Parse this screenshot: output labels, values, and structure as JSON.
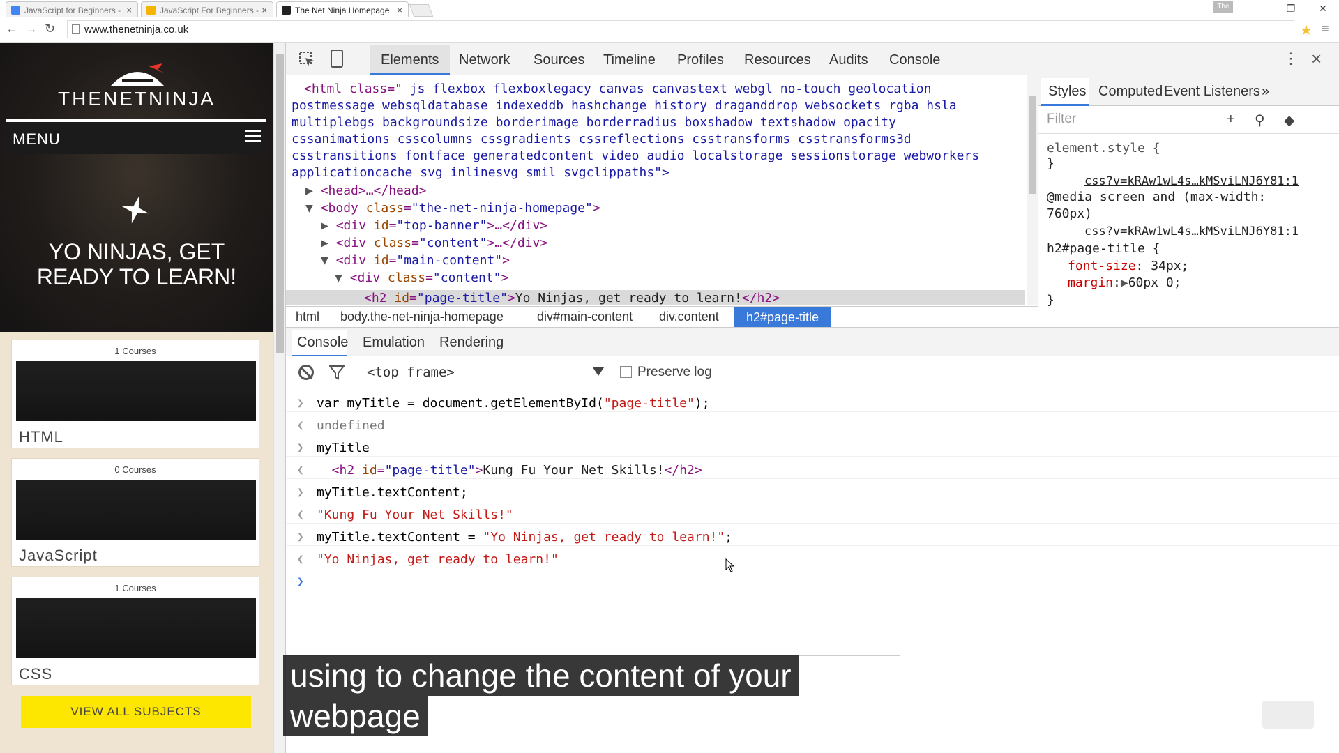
{
  "browser": {
    "tabs": [
      {
        "title": "JavaScript for Beginners -",
        "active": false,
        "favicon_color": "#4285f4"
      },
      {
        "title": "JavaScript For Beginners -",
        "active": false,
        "favicon_color": "#f4b400"
      },
      {
        "title": "The Net Ninja Homepage",
        "active": true,
        "favicon_color": "#222222"
      }
    ],
    "user_badge": "The",
    "window_controls": {
      "minimize": "–",
      "restore": "❐",
      "close": "✕"
    },
    "url": "www.thenetninja.co.uk"
  },
  "site": {
    "logo_text": "THENETNINJA",
    "menu_label": "MENU",
    "hero_title_line1": "YO NINJAS, GET",
    "hero_title_line2": "READY TO LEARN!",
    "cards": [
      {
        "count": "1 Courses",
        "name": "HTML"
      },
      {
        "count": "0 Courses",
        "name": "JavaScript"
      },
      {
        "count": "1 Courses",
        "name": "CSS"
      }
    ],
    "view_all": "VIEW ALL SUBJECTS",
    "accent": "#fde600",
    "logo_accent": "#e8332a"
  },
  "devtools": {
    "tabs": [
      "Elements",
      "Network",
      "Sources",
      "Timeline",
      "Profiles",
      "Resources",
      "Audits",
      "Console"
    ],
    "active_tab": "Elements",
    "elements": {
      "html_open": "<html class=\"",
      "html_classes_1": " js flexbox flexboxlegacy canvas canvastext webgl no-touch geolocation",
      "html_classes_2": "postmessage websqldatabase indexeddb hashchange history draganddrop websockets rgba hsla",
      "html_classes_3": "multiplebgs backgroundsize borderimage borderradius boxshadow textshadow opacity",
      "html_classes_4": "cssanimations csscolumns cssgradients cssreflections csstransforms csstransforms3d",
      "html_classes_5": "csstransitions fontface generatedcontent video audio localstorage sessionstorage webworkers",
      "html_classes_6": "applicationcache svg inlinesvg smil svgclippaths",
      "html_close": "\">",
      "head": "<head>…</head>",
      "body_tag": "<body",
      "body_attr": "class",
      "body_val": "\"the-net-ninja-homepage\"",
      "div1_attr": "id",
      "div1_val": "\"top-banner\"",
      "div2_attr": "class",
      "div2_val": "\"content\"",
      "div3_attr": "id",
      "div3_val": "\"main-content\"",
      "div4_attr": "class",
      "div4_val": "\"content\"",
      "h2_attr": "id",
      "h2_val": "\"page-title\"",
      "h2_text": "Yo Ninjas, get ready to learn!",
      "collapsed": ">…</div>",
      "div_open": "<div",
      "gt": ">",
      "h2_open": "<h2",
      "h2_close": "</h2>"
    },
    "breadcrumbs": [
      "html",
      "body.the-net-ninja-homepage",
      "div#main-content",
      "div.content",
      "h2#page-title"
    ],
    "styles_panel": {
      "tabs": [
        "Styles",
        "Computed",
        "Event Listeners",
        "»"
      ],
      "filter_placeholder": "Filter",
      "element_style": "element.style {",
      "close_brace": "}",
      "source_link": "css?v=kRAw1wL4s…kMSviLNJ6Y81:1",
      "media_line1": "@media screen and (max-width:",
      "media_line2": "760px)",
      "selector": "h2#page-title {",
      "prop1_name": "font-size",
      "prop1_value": " 34px;",
      "prop2_name": "margin",
      "prop2_value": "60px 0;"
    },
    "drawer_tabs": [
      "Console",
      "Emulation",
      "Rendering"
    ],
    "console": {
      "frame": "<top frame>",
      "preserve_log": "Preserve log",
      "lines": [
        {
          "prefix": ">",
          "parts": [
            [
              "",
              "var myTitle = document.getElementById("
            ],
            [
              "str",
              "\"page-title\""
            ],
            [
              "",
              ");"
            ]
          ]
        },
        {
          "prefix": "<",
          "parts": [
            [
              "gray",
              "undefined"
            ]
          ]
        },
        {
          "prefix": ">",
          "parts": [
            [
              "",
              "myTitle"
            ]
          ]
        },
        {
          "prefix": "<",
          "parts": [
            [
              "tagc",
              "  <h2 "
            ],
            [
              "attn",
              "id"
            ],
            [
              "tagc",
              "="
            ],
            [
              "attv",
              "\"page-title\""
            ],
            [
              "tagc",
              ">"
            ],
            [
              "txt",
              "Kung Fu Your Net Skills!"
            ],
            [
              "tagc",
              "</h2>"
            ]
          ]
        },
        {
          "prefix": ">",
          "parts": [
            [
              "",
              "myTitle.textContent;"
            ]
          ]
        },
        {
          "prefix": "<",
          "parts": [
            [
              "str",
              "\"Kung Fu Your Net Skills!\""
            ]
          ]
        },
        {
          "prefix": ">",
          "parts": [
            [
              "",
              "myTitle.textContent = "
            ],
            [
              "str",
              "\"Yo Ninjas, get ready to learn!\""
            ],
            [
              "",
              ";"
            ]
          ]
        },
        {
          "prefix": "<",
          "parts": [
            [
              "str",
              "\"Yo Ninjas, get ready to learn!\""
            ]
          ]
        }
      ],
      "prompt": ">"
    }
  },
  "caption": {
    "line1": "using to change the content of your",
    "line2": "webpage"
  }
}
